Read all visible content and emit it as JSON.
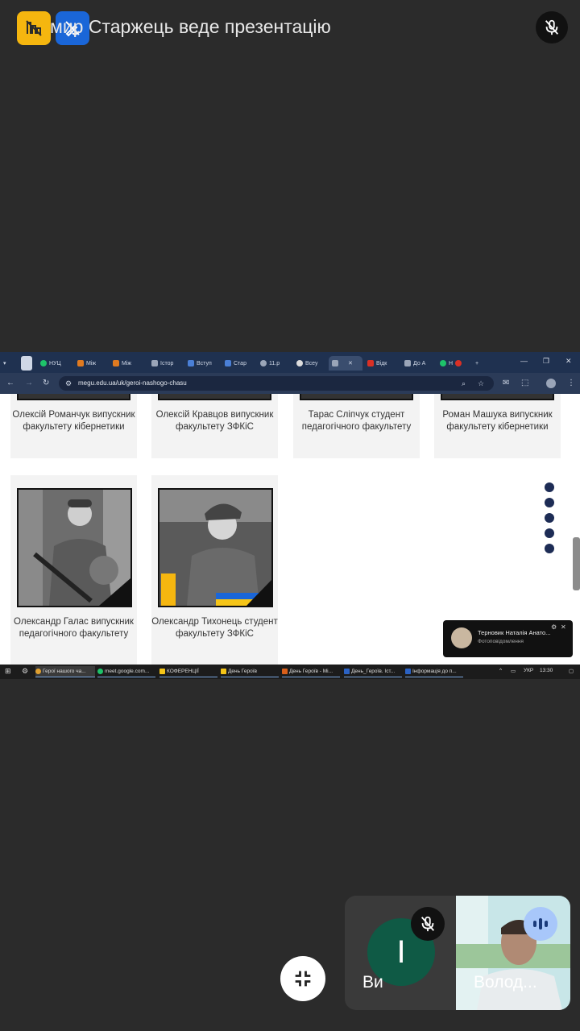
{
  "meet": {
    "presenting_title": "мир Старжець веде презентацію",
    "tiles": {
      "self_initial": "I",
      "self_name": "Ви",
      "remote_name": "Волод..."
    }
  },
  "browser": {
    "tabs": [
      "НУЦ",
      "Між",
      "Між",
      "Істор",
      "Вступ",
      "Стар",
      "11.р",
      "Всеу",
      "",
      "Відк",
      "До А",
      "Н"
    ],
    "url": "megu.edu.ua/uk/geroi-nashogo-chasu",
    "win_controls": [
      "—",
      "❐",
      "✕"
    ]
  },
  "page": {
    "top_cards": [
      "Олексій Романчук випускник факультету кібернетики",
      "Олексій Кравцов випускник факультету ЗФКіС",
      "Тарас Сліпчук студент педагогічного факультету",
      "Роман Машука випускник факультету кібернетики"
    ],
    "bottom_cards": [
      "Олександр Галас випускник педагогічного факультету",
      "Олександр Тихонець студент факультету ЗФКіС"
    ],
    "socials": [
      "facebook-icon",
      "telegram-icon",
      "youtube-icon",
      "twitter-icon",
      "instagram-icon"
    ]
  },
  "notification": {
    "name": "Терновик Наталія Анато...",
    "subtitle": "Фотоповідомлення"
  },
  "taskbar": {
    "items": [
      "Герої нашого ча...",
      "meet.google.com...",
      "КОФЕРЕНЦІЇ",
      "День Героїв",
      "День Героїв - Mi...",
      "День_Героїв. Іст...",
      "Інформація до п..."
    ],
    "lang": "УКР",
    "time": "13:30"
  },
  "colors": {
    "background": "#2b2b2b",
    "chrome_tab_bg": "#1f3150",
    "yellow_badge": "#f5b60f",
    "blue_badge": "#1a66d8",
    "self_avatar": "#0f5a45"
  }
}
